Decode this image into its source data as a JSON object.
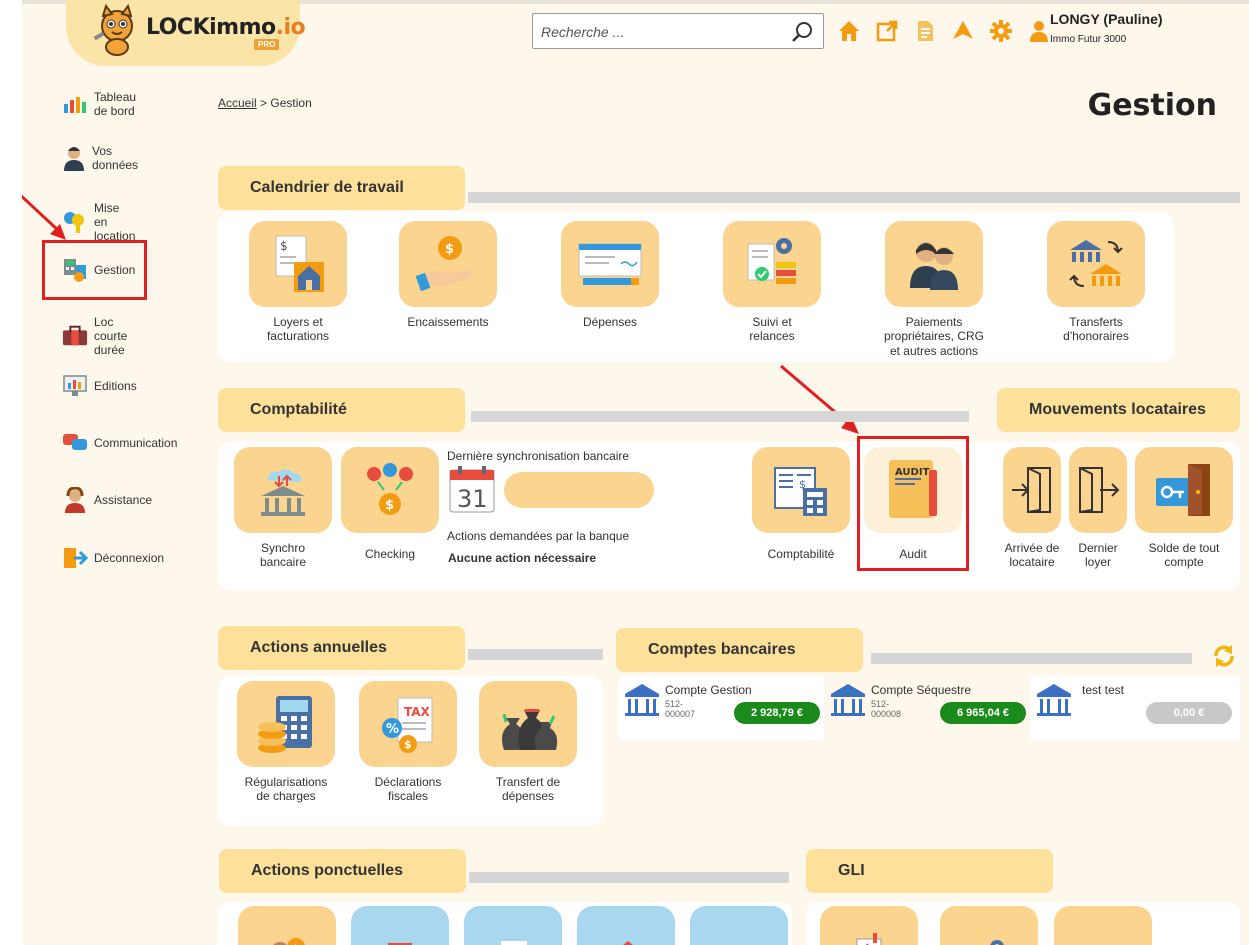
{
  "app": {
    "logo_text": "LOCKimmo",
    "logo_suffix": ".io",
    "logo_badge": "PRO"
  },
  "search": {
    "placeholder": "Recherche ..."
  },
  "user": {
    "name": "LONGY (Pauline)",
    "company": "Immo Futur 3000"
  },
  "topbar_icons": [
    "home-icon",
    "external-link-icon",
    "document-icon",
    "plane-icon",
    "gear-icon",
    "user-icon"
  ],
  "sidebar": {
    "items": [
      {
        "label": "Tableau de bord",
        "icon": "dashboard-icon"
      },
      {
        "label": "Vos données",
        "icon": "person-icon"
      },
      {
        "label": "Mise en location",
        "icon": "keys-icon"
      },
      {
        "label": "Gestion",
        "icon": "calculator-icon"
      },
      {
        "label": "Loc courte durée",
        "icon": "suitcase-icon"
      },
      {
        "label": "Editions",
        "icon": "monitor-chart-icon"
      },
      {
        "label": "Communication",
        "icon": "chat-bubbles-icon"
      },
      {
        "label": "Assistance",
        "icon": "support-agent-icon"
      },
      {
        "label": "Déconnexion",
        "icon": "logout-icon"
      }
    ]
  },
  "breadcrumb": {
    "home": "Accueil",
    "separator": ">",
    "current": "Gestion"
  },
  "page_title": "Gestion",
  "calendrier": {
    "title": "Calendrier de travail",
    "tiles": [
      {
        "label1": "Loyers et",
        "label2": "facturations",
        "icon": "invoice-house-icon"
      },
      {
        "label1": "Encaissements",
        "label2": "",
        "icon": "hand-coin-icon"
      },
      {
        "label1": "Dépenses",
        "label2": "",
        "icon": "cheque-icon"
      },
      {
        "label1": "Suivi et",
        "label2": "relances",
        "icon": "tracking-gear-icon"
      },
      {
        "label1": "Paiements",
        "label2": "propriétaires, CRG",
        "label3": "et autres actions",
        "icon": "owners-icon"
      },
      {
        "label1": "Transferts",
        "label2": "d'honoraires",
        "icon": "bank-transfer-icon"
      }
    ]
  },
  "comptabilite": {
    "title": "Comptabilité",
    "tiles": [
      {
        "label1": "Synchro",
        "label2": "bancaire",
        "icon": "bank-sync-icon"
      },
      {
        "label1": "Checking",
        "label2": "",
        "icon": "coins-check-icon"
      },
      {
        "label1": "Comptabilité",
        "label2": "",
        "icon": "ledger-calculator-icon"
      },
      {
        "label1": "Audit",
        "label2": "",
        "icon": "audit-folder-icon"
      }
    ],
    "sync_label": "Dernière synchronisation bancaire",
    "calendar_day": "31",
    "bank_actions_label": "Actions demandées par la banque",
    "bank_actions_value": "Aucune action nécessaire"
  },
  "mouvements": {
    "title": "Mouvements locataires",
    "tiles": [
      {
        "label1": "Arrivée de",
        "label2": "locataire",
        "icon": "door-enter-icon"
      },
      {
        "label1": "Dernier",
        "label2": "loyer",
        "icon": "door-exit-icon"
      },
      {
        "label1": "Solde de tout",
        "label2": "compte",
        "icon": "key-door-icon"
      }
    ]
  },
  "annuelles": {
    "title": "Actions annuelles",
    "tiles": [
      {
        "label1": "Régularisations",
        "label2": "de charges",
        "icon": "calculator-coins-icon"
      },
      {
        "label1": "Déclarations",
        "label2": "fiscales",
        "icon": "tax-icon"
      },
      {
        "label1": "Transfert de",
        "label2": "dépenses",
        "icon": "money-bags-icon"
      }
    ]
  },
  "comptes": {
    "title": "Comptes bancaires",
    "refresh_icon": "refresh-icon",
    "accounts": [
      {
        "name": "Compte Gestion",
        "num1": "512-",
        "num2": "000007",
        "balance": "2 928,79 €",
        "color": "#1a8a1a"
      },
      {
        "name": "Compte Séquestre",
        "num1": "512-",
        "num2": "000008",
        "balance": "6 965,04 €",
        "color": "#1a8a1a"
      },
      {
        "name": "test test",
        "num1": "",
        "num2": "",
        "balance": "0,00 €",
        "color": "#c8c8c8"
      }
    ]
  },
  "ponctuelles": {
    "title": "Actions ponctuelles"
  },
  "gli": {
    "title": "GLI"
  },
  "colors": {
    "accent": "#fbd48f",
    "tab": "#fde09a",
    "annotation": "#e02020",
    "background": "#fef7eb"
  }
}
